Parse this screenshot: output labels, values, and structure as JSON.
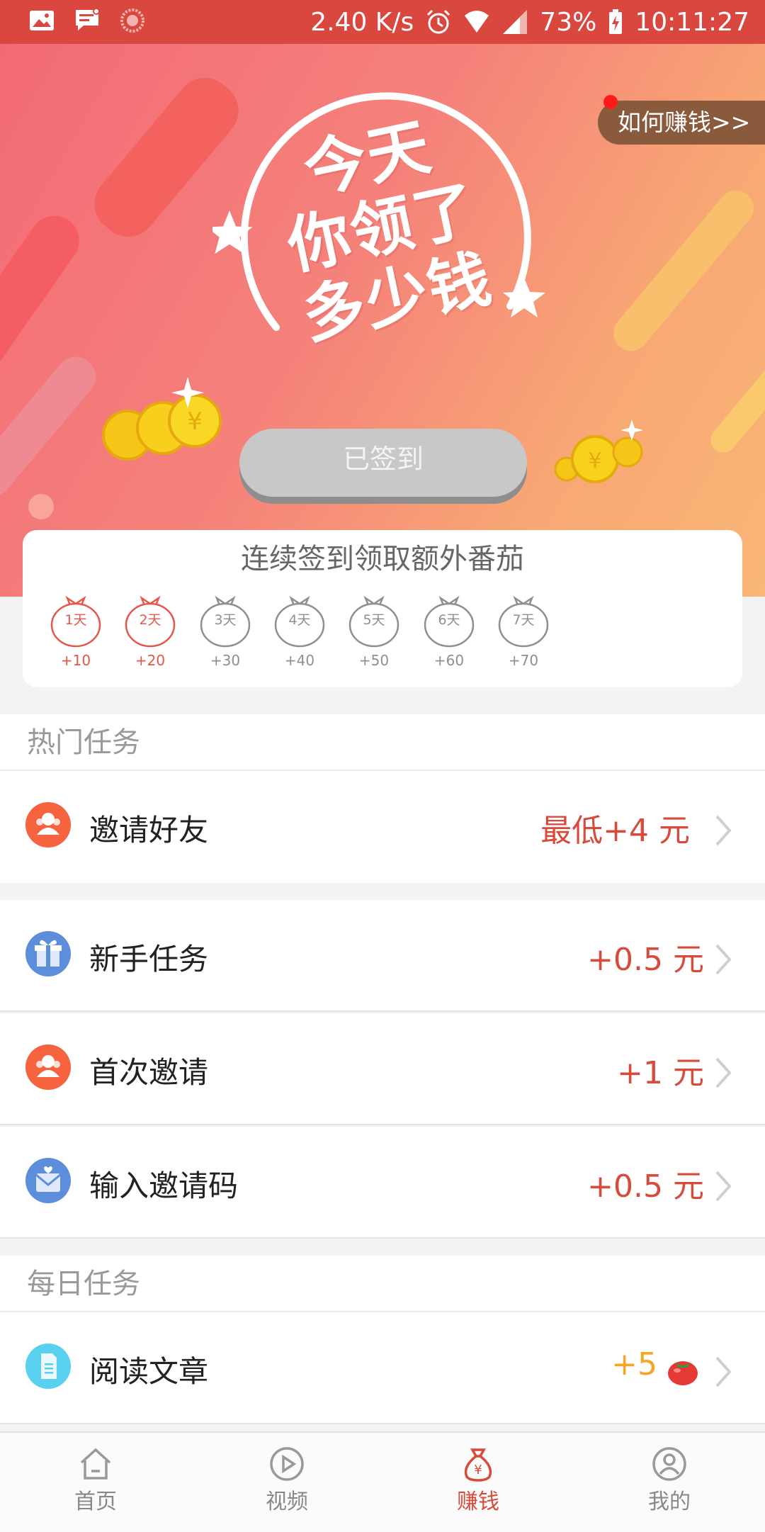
{
  "status_bar": {
    "net_speed": "2.40 K/s",
    "battery": "73%",
    "time": "10:11:27",
    "bg_color": "#d9473f"
  },
  "banner": {
    "slogan_lines": [
      "今天",
      "你领了",
      "多少钱"
    ],
    "how_to_earn": "如何赚钱>>",
    "checkin_button": "已签到"
  },
  "sign_in": {
    "title": "连续签到领取额外番茄",
    "days": [
      {
        "label": "1天",
        "reward": "+10",
        "done": true
      },
      {
        "label": "2天",
        "reward": "+20",
        "done": true
      },
      {
        "label": "3天",
        "reward": "+30",
        "done": false
      },
      {
        "label": "4天",
        "reward": "+40",
        "done": false
      },
      {
        "label": "5天",
        "reward": "+50",
        "done": false
      },
      {
        "label": "6天",
        "reward": "+60",
        "done": false
      },
      {
        "label": "7天",
        "reward": "+70",
        "done": false
      }
    ]
  },
  "hot_tasks": {
    "title": "热门任务",
    "invite_friends": {
      "label": "邀请好友",
      "value": "最低+4 元",
      "icon": "friends-icon"
    },
    "items": [
      {
        "label": "新手任务",
        "value": "+0.5 元",
        "icon": "gift-icon"
      },
      {
        "label": "首次邀请",
        "value": "+1 元",
        "icon": "friends-icon"
      },
      {
        "label": "输入邀请码",
        "value": "+0.5 元",
        "icon": "envelope-icon"
      }
    ]
  },
  "daily_tasks": {
    "title": "每日任务",
    "items": [
      {
        "label": "阅读文章",
        "value": "+5",
        "icon": "document-icon",
        "reward_icon": "tomato-icon"
      }
    ]
  },
  "bottom_nav": {
    "items": [
      {
        "label": "首页",
        "icon": "home-icon"
      },
      {
        "label": "视频",
        "icon": "play-icon"
      },
      {
        "label": "赚钱",
        "icon": "money-bag-icon",
        "active": true
      },
      {
        "label": "我的",
        "icon": "profile-icon"
      }
    ]
  },
  "colors": {
    "accent": "#d84a3c",
    "reward_gold": "#f5a623"
  }
}
